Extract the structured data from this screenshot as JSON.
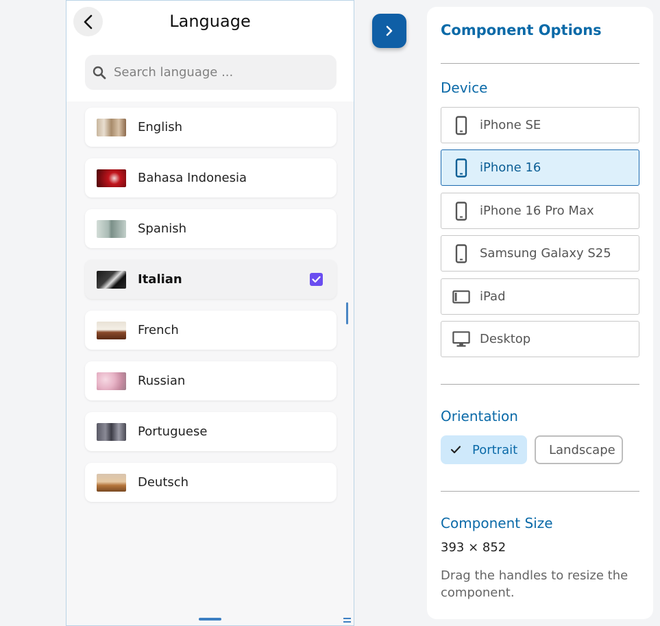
{
  "phone": {
    "title": "Language",
    "search_placeholder": "Search language ...",
    "languages": [
      {
        "label": "English",
        "selected": false
      },
      {
        "label": "Bahasa Indonesia",
        "selected": false
      },
      {
        "label": "Spanish",
        "selected": false
      },
      {
        "label": "Italian",
        "selected": true
      },
      {
        "label": "French",
        "selected": false
      },
      {
        "label": "Russian",
        "selected": false
      },
      {
        "label": "Portuguese",
        "selected": false
      },
      {
        "label": "Deutsch",
        "selected": false
      }
    ]
  },
  "panel": {
    "title": "Component Options",
    "device_heading": "Device",
    "devices": [
      {
        "label": "iPhone SE",
        "icon": "phone-icon",
        "selected": false
      },
      {
        "label": "iPhone 16",
        "icon": "phone-icon",
        "selected": true
      },
      {
        "label": "iPhone 16 Pro Max",
        "icon": "phone-icon",
        "selected": false
      },
      {
        "label": "Samsung Galaxy S25",
        "icon": "phone-icon",
        "selected": false
      },
      {
        "label": "iPad",
        "icon": "tablet-icon",
        "selected": false
      },
      {
        "label": "Desktop",
        "icon": "desktop-icon",
        "selected": false
      }
    ],
    "orientation_heading": "Orientation",
    "orientation_portrait": "Portrait",
    "orientation_landscape": "Landscape",
    "size_heading": "Component Size",
    "size_value": "393 × 852",
    "size_hint": "Drag the handles to resize the component."
  },
  "colors": {
    "accent": "#0b6aa8",
    "toggle_button": "#0f5fa6",
    "checkbox": "#6a4df0",
    "selected_device_bg": "#ddf0fb"
  }
}
